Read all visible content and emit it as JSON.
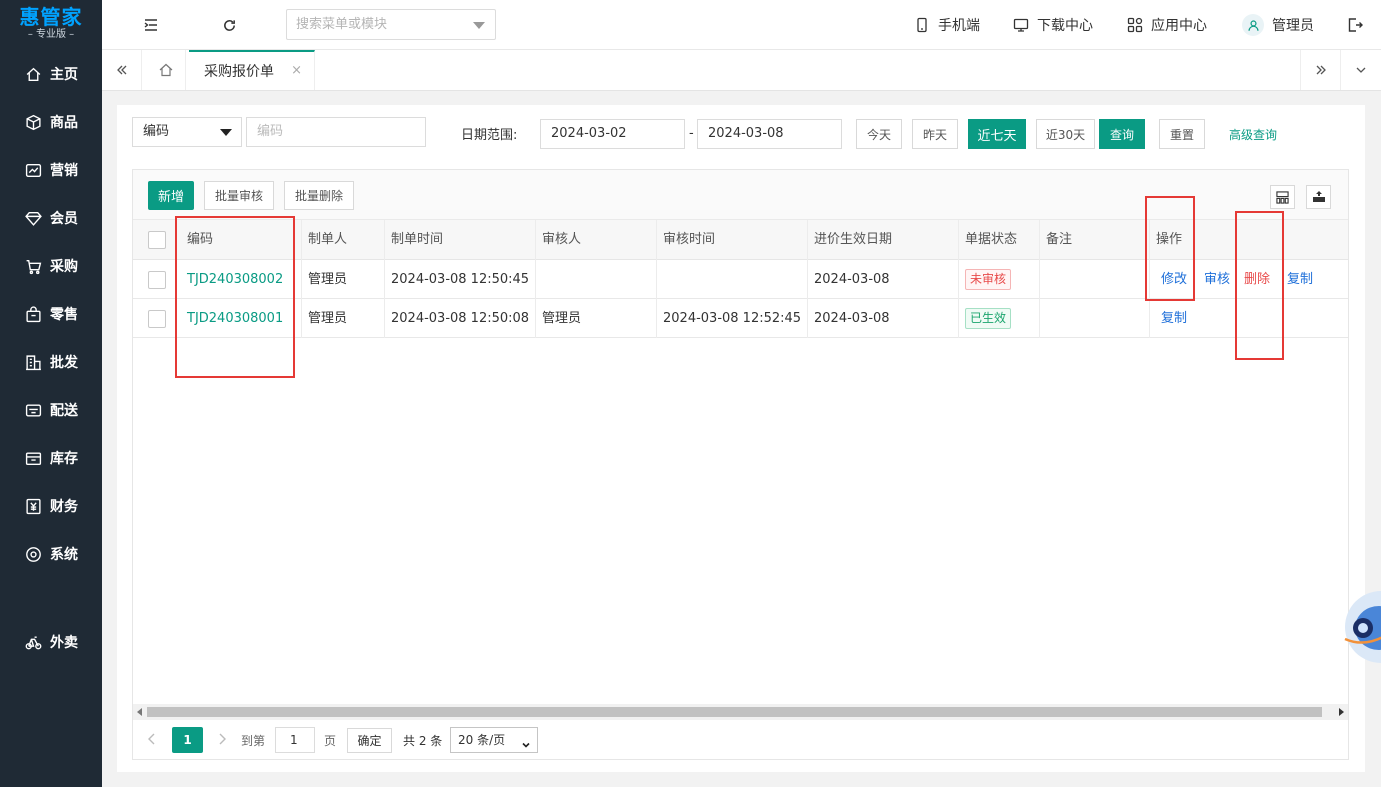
{
  "app": {
    "logo_name": "惠管家",
    "logo_sub": "– 专业版 –"
  },
  "colors": {
    "accent": "#0a9b84",
    "sidebar_bg": "#1f2a35",
    "link_blue": "#1e6fd9",
    "danger": "#e84a4a"
  },
  "sidebar": {
    "items": [
      {
        "label": "主页",
        "icon": "home-icon"
      },
      {
        "label": "商品",
        "icon": "cube-icon"
      },
      {
        "label": "营销",
        "icon": "chart-icon"
      },
      {
        "label": "会员",
        "icon": "diamond-icon"
      },
      {
        "label": "采购",
        "icon": "cart-icon"
      },
      {
        "label": "零售",
        "icon": "bag-icon"
      },
      {
        "label": "批发",
        "icon": "building-icon"
      },
      {
        "label": "配送",
        "icon": "truck-icon"
      },
      {
        "label": "库存",
        "icon": "box-icon"
      },
      {
        "label": "财务",
        "icon": "yen-icon"
      },
      {
        "label": "系统",
        "icon": "gear-icon"
      },
      {
        "label": "外卖",
        "icon": "bike-icon"
      }
    ]
  },
  "topbar": {
    "search_placeholder": "搜索菜单或模块",
    "mobile": "手机端",
    "download": "下载中心",
    "apps": "应用中心",
    "user": "管理员"
  },
  "tabs": {
    "active_label": "采购报价单",
    "close_glyph": "×"
  },
  "filter": {
    "field_select": "编码",
    "field_placeholder": "编码",
    "date_label": "日期范围:",
    "date_from": "2024-03-02",
    "date_sep": "-",
    "date_to": "2024-03-08",
    "today": "今天",
    "yesterday": "昨天",
    "last7": "近七天",
    "last30": "近30天",
    "query": "查询",
    "reset": "重置",
    "advanced": "高级查询"
  },
  "toolbar": {
    "add": "新增",
    "batch_audit": "批量审核",
    "batch_delete": "批量删除"
  },
  "table": {
    "headers": [
      "编码",
      "制单人",
      "制单时间",
      "审核人",
      "审核时间",
      "进价生效日期",
      "单据状态",
      "备注",
      "操作"
    ],
    "rows": [
      {
        "code": "TJD240308002",
        "maker": "管理员",
        "make_time": "2024-03-08 12:50:45",
        "auditor": "",
        "audit_time": "",
        "effective_date": "2024-03-08",
        "status": "未审核",
        "remark": "",
        "ops": [
          "修改",
          "审核",
          "删除",
          "复制"
        ]
      },
      {
        "code": "TJD240308001",
        "maker": "管理员",
        "make_time": "2024-03-08 12:50:08",
        "auditor": "管理员",
        "audit_time": "2024-03-08 12:52:45",
        "effective_date": "2024-03-08",
        "status": "已生效",
        "remark": "",
        "ops": [
          "复制"
        ]
      }
    ]
  },
  "pager": {
    "current": "1",
    "goto_label": "到第",
    "goto_value": "1",
    "page_unit": "页",
    "confirm": "确定",
    "total": "共 2 条",
    "page_size": "20 条/页"
  }
}
